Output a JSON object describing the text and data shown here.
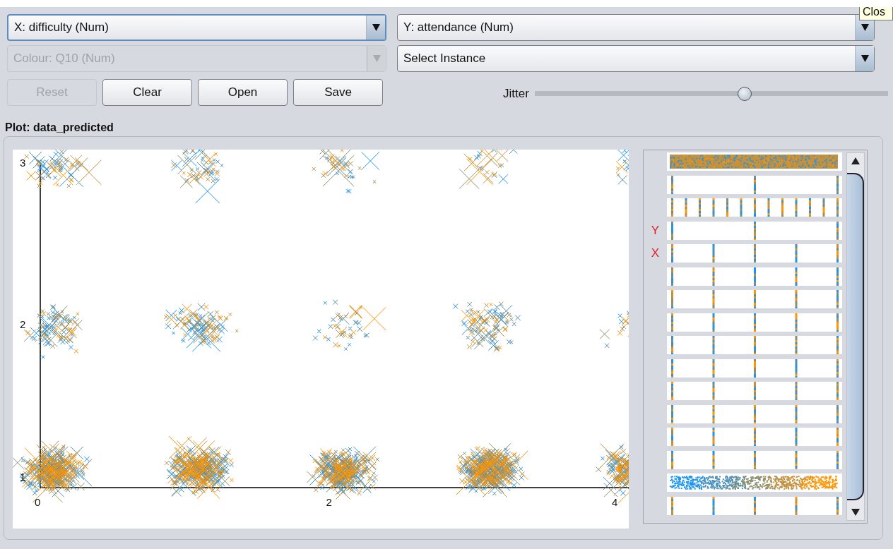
{
  "tooltip": {
    "text": "Clos"
  },
  "selectors": [
    {
      "value": "X: difficulty (Num)",
      "disabled": false,
      "focused": true
    },
    {
      "value": "Y: attendance (Num)",
      "disabled": false,
      "focused": false
    },
    {
      "value": "Colour: Q10 (Num)",
      "disabled": true,
      "focused": false
    },
    {
      "value": "Select Instance",
      "disabled": false,
      "focused": false
    }
  ],
  "buttons": [
    {
      "label": "Reset",
      "disabled": true
    },
    {
      "label": "Clear",
      "disabled": false
    },
    {
      "label": "Open",
      "disabled": false
    },
    {
      "label": "Save",
      "disabled": false
    }
  ],
  "jitter": {
    "label": "Jitter",
    "level": 0.595
  },
  "plot": {
    "title": "Plot: data_predicted",
    "x_ticks": [
      "0",
      "2",
      "4"
    ],
    "y_ticks": [
      "3",
      "2",
      "1"
    ]
  },
  "attribute_bars": [
    {
      "kind": "dense"
    },
    {
      "kind": "lines"
    },
    {
      "kind": "lines"
    },
    {
      "kind": "lines",
      "marker": "Y"
    },
    {
      "kind": "lines",
      "marker": "X"
    },
    {
      "kind": "lines"
    },
    {
      "kind": "lines"
    },
    {
      "kind": "lines"
    },
    {
      "kind": "lines"
    },
    {
      "kind": "lines"
    },
    {
      "kind": "lines"
    },
    {
      "kind": "lines"
    },
    {
      "kind": "lines"
    },
    {
      "kind": "lines"
    },
    {
      "kind": "gradient"
    },
    {
      "kind": "lines"
    }
  ]
}
